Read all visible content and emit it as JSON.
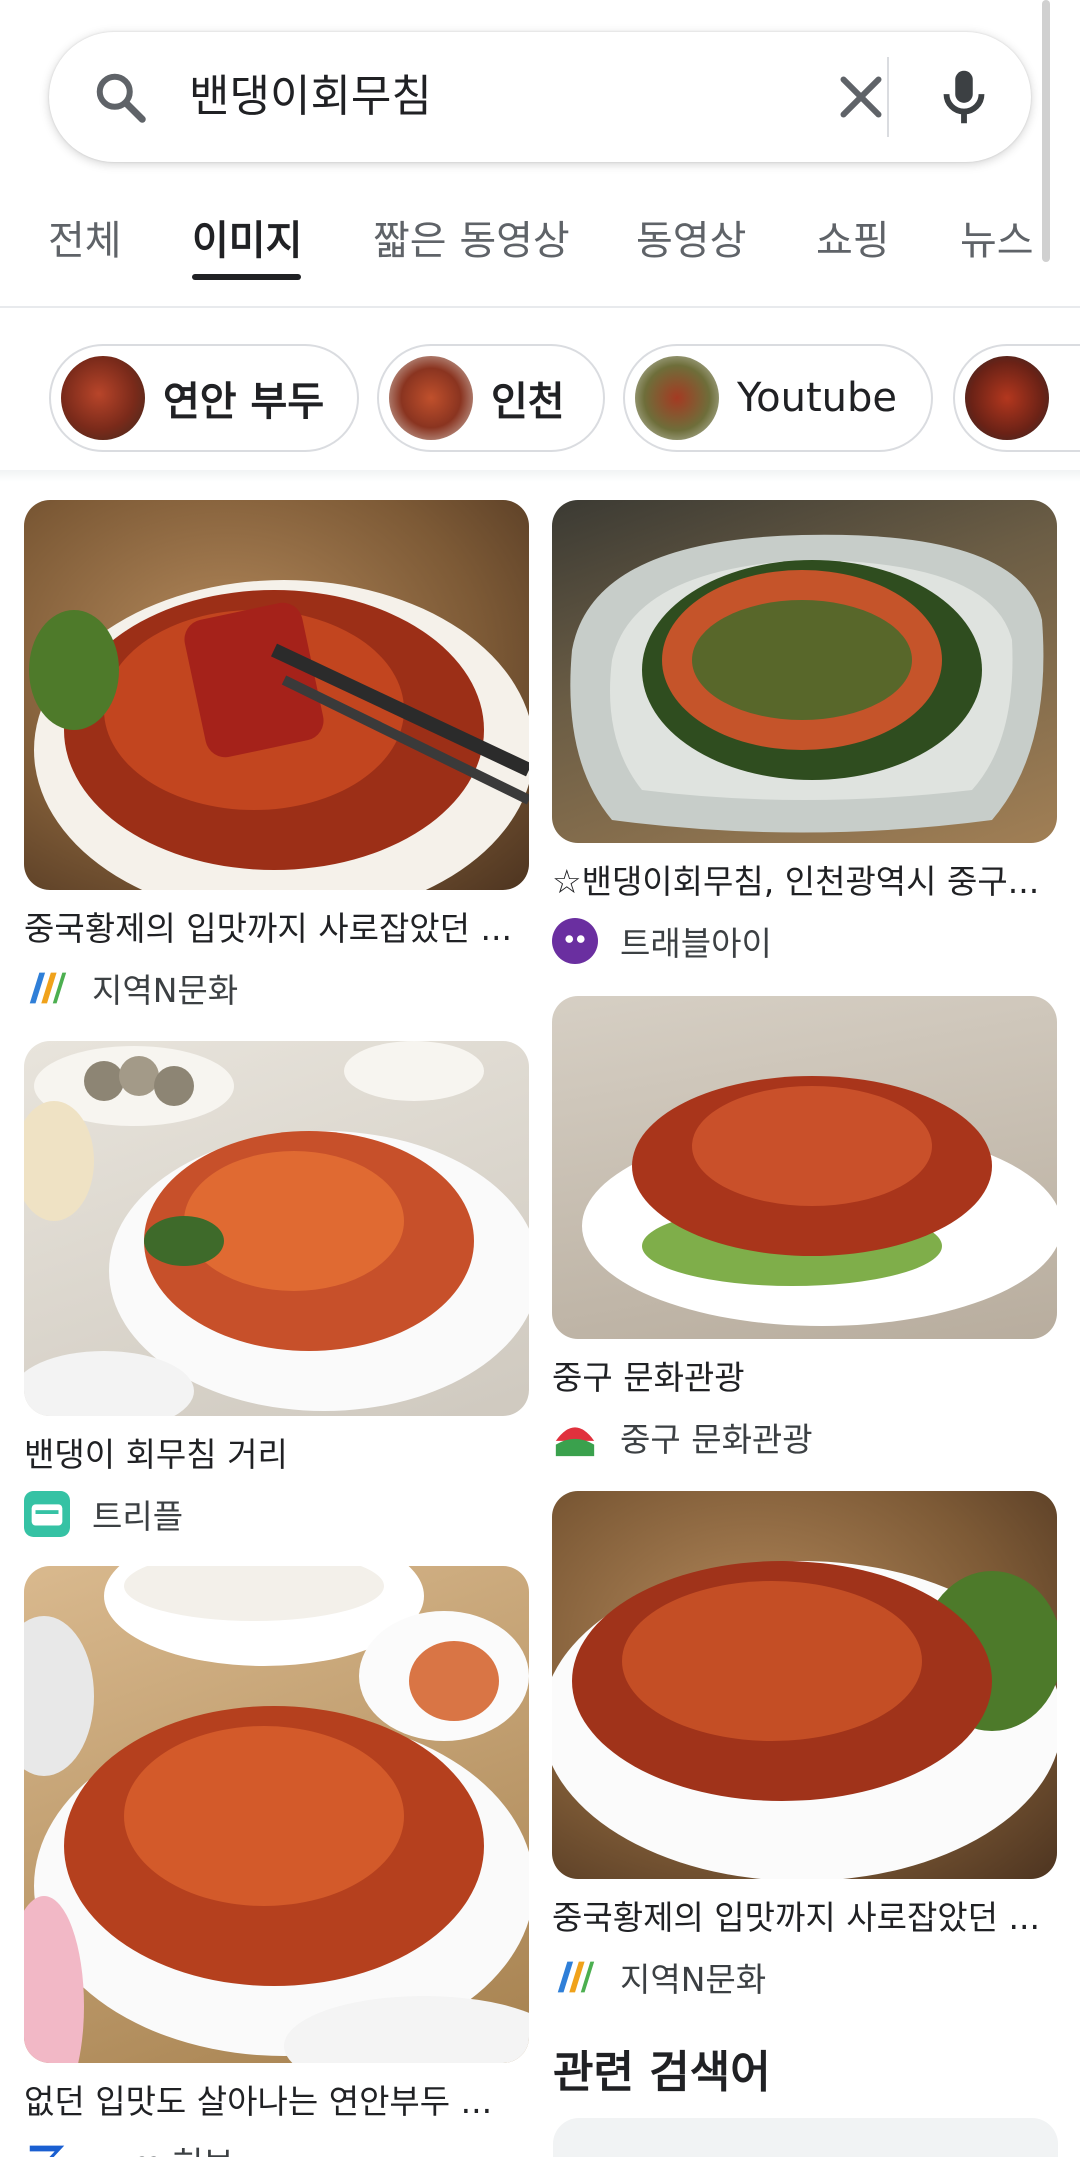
{
  "search": {
    "query": "밴댕이회무침",
    "icons": {
      "search": "search-icon",
      "clear": "close-icon",
      "voice": "microphone-icon"
    }
  },
  "tabs": [
    {
      "label": "전체",
      "active": false
    },
    {
      "label": "이미지",
      "active": true
    },
    {
      "label": "짧은 동영상",
      "active": false
    },
    {
      "label": "동영상",
      "active": false
    },
    {
      "label": "쇼핑",
      "active": false
    },
    {
      "label": "뉴스",
      "active": false
    }
  ],
  "chips": [
    {
      "label": "연안 부두"
    },
    {
      "label": "인천"
    },
    {
      "label": "Youtube"
    },
    {
      "label": ""
    }
  ],
  "results": {
    "left": [
      {
        "title": "중국황제의 입맛까지 사로잡았던 ...",
        "source": "지역N문화"
      },
      {
        "title": "밴댕이 회무침 거리",
        "source": "트리플"
      },
      {
        "title": "없던 입맛도 살아나는 연안부두 ...",
        "source": "zum 허브"
      }
    ],
    "right": [
      {
        "title": "☆밴댕이회무침, 인천광역시 중구...",
        "source": "트래블아이"
      },
      {
        "title": "중구 문화관광",
        "source": "중구 문화관광"
      },
      {
        "title": "중국황제의 입맛까지 사로잡았던 ...",
        "source": "지역N문화"
      }
    ]
  },
  "related": {
    "heading": "관련 검색어"
  },
  "colors": {
    "accent": "#202124",
    "chip_border": "#dadce0",
    "dish_red": "#a8321c",
    "dish_orange": "#d9622b"
  }
}
